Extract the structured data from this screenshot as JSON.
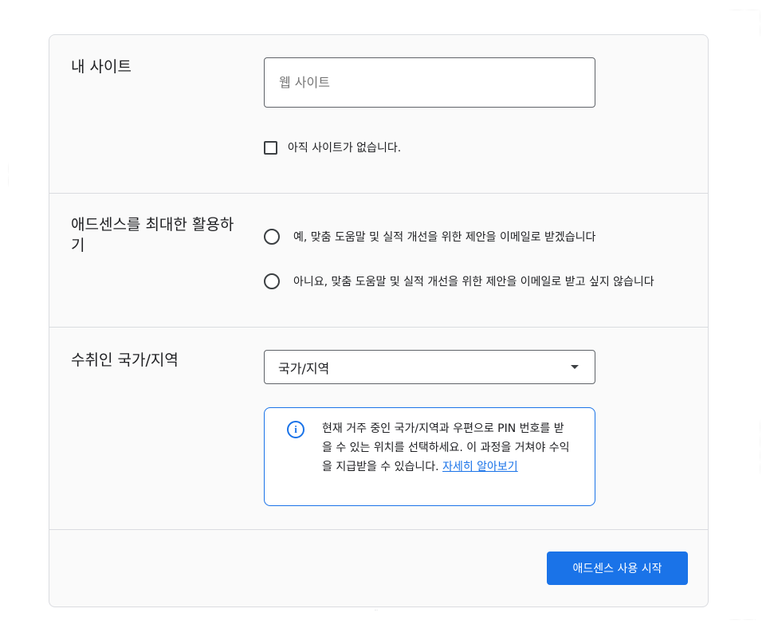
{
  "site_section": {
    "title": "내 사이트",
    "input_placeholder": "웹 사이트",
    "checkbox_label": "아직 사이트가 없습니다."
  },
  "optimize_section": {
    "title": "애드센스를 최대한 활용하기",
    "options": [
      {
        "label": "예, 맞춤 도움말 및 실적 개선을 위한 제안을 이메일로 받겠습니다"
      },
      {
        "label": "아니요, 맞춤 도움말 및 실적 개선을 위한 제안을 이메일로 받고 싶지 않습니다"
      }
    ]
  },
  "country_section": {
    "title": "수취인 국가/지역",
    "select_value": "국가/지역",
    "info_text": "현재 거주 중인 국가/지역과 우편으로 PIN 번호를 받을 수 있는 위치를 선택하세요. 이 과정을 거쳐야 수익을 지급받을 수 있습니다.",
    "info_link": "자세히 알아보기"
  },
  "footer": {
    "start_button": "애드센스 사용 시작"
  },
  "watermark": "...",
  "colors": {
    "accent": "#1a73e8",
    "border": "#dadce0",
    "text": "#202124"
  }
}
